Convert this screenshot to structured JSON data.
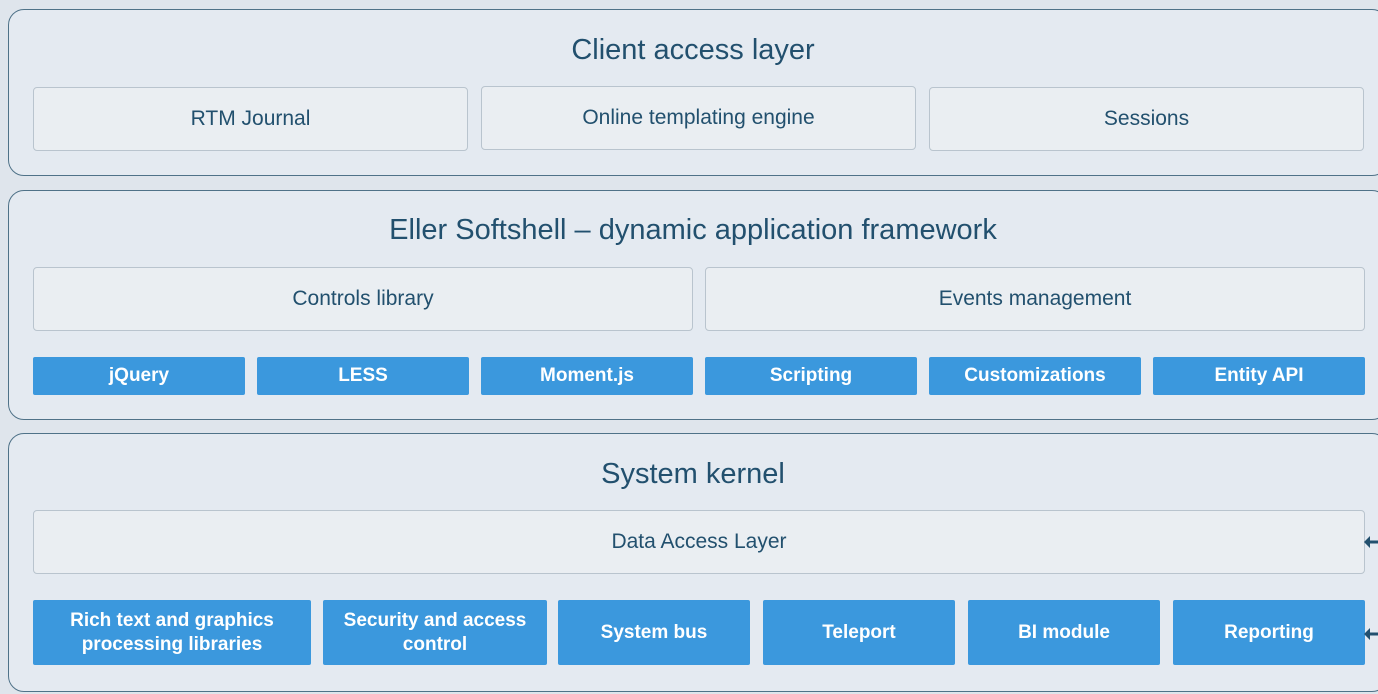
{
  "client_layer": {
    "title": "Client access layer",
    "boxes": [
      "RTM Journal",
      "Online templating engine",
      "Sessions"
    ]
  },
  "framework_layer": {
    "title": "Eller Softshell – dynamic application framework",
    "boxes": [
      "Controls library",
      "Events management"
    ],
    "chips": [
      "jQuery",
      "LESS",
      "Moment.js",
      "Scripting",
      "Customizations",
      "Entity API"
    ]
  },
  "kernel_layer": {
    "title": "System kernel",
    "data_access": "Data Access Layer",
    "chips": [
      {
        "line1": "Rich text and graphics",
        "line2": "processing libraries"
      },
      {
        "line1": "Security and access",
        "line2": "control"
      },
      {
        "line1": "System bus",
        "line2": ""
      },
      {
        "line1": "Teleport",
        "line2": ""
      },
      {
        "line1": "BI module",
        "line2": ""
      },
      {
        "line1": "Reporting",
        "line2": ""
      }
    ],
    "arrows": [
      "left-arrow-icon",
      "left-arrow-icon"
    ]
  },
  "colors": {
    "background": "#dfe5ec",
    "panel": "#e4eaf1",
    "panel_border": "#4f7288",
    "title_text": "#22506e",
    "chip_fill": "#3b98dd",
    "arrow": "#22506e"
  }
}
